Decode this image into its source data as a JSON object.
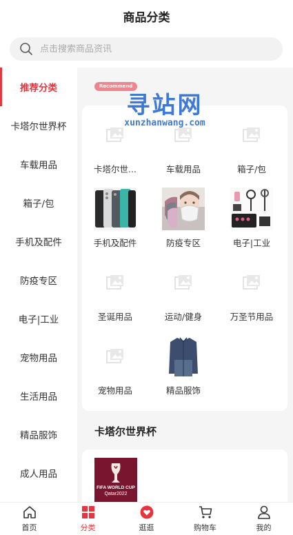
{
  "header": {
    "title": "商品分类"
  },
  "search": {
    "placeholder": "点击搜索商品资讯"
  },
  "sidebar": {
    "items": [
      {
        "label": "推荐分类",
        "active": true
      },
      {
        "label": "卡塔尔世界杯"
      },
      {
        "label": "车载用品"
      },
      {
        "label": "箱子/包"
      },
      {
        "label": "手机及配件"
      },
      {
        "label": "防疫专区"
      },
      {
        "label": "电子|工业"
      },
      {
        "label": "宠物用品"
      },
      {
        "label": "生活用品"
      },
      {
        "label": "精品服饰"
      },
      {
        "label": "成人用品"
      }
    ]
  },
  "content": {
    "badge": "Recommend",
    "watermark": {
      "text": "寻站网",
      "url": "xunzhanwang.com"
    },
    "grid": [
      {
        "label": "卡塔尔世...",
        "image": "placeholder-icon"
      },
      {
        "label": "车载用品",
        "image": "placeholder-icon"
      },
      {
        "label": "箱子/包",
        "image": "placeholder-icon"
      },
      {
        "label": "手机及配件",
        "image": "phones"
      },
      {
        "label": "防疫专区",
        "image": "masks"
      },
      {
        "label": "电子|工业",
        "image": "electronics"
      },
      {
        "label": "圣诞用品",
        "image": "placeholder-icon"
      },
      {
        "label": "运动/健身",
        "image": "placeholder-icon"
      },
      {
        "label": "万圣节用品",
        "image": "placeholder-icon"
      },
      {
        "label": "宠物用品",
        "image": "placeholder-icon"
      },
      {
        "label": "精品服饰",
        "image": "shirt"
      }
    ],
    "section_title": "卡塔尔世界杯",
    "section_item": {
      "logo_line1": "FIFA WORLD CUP",
      "logo_line2": "Qatar2022"
    }
  },
  "tabbar": {
    "tabs": [
      {
        "label": "首页",
        "icon": "home-icon"
      },
      {
        "label": "分类",
        "icon": "category-icon",
        "active": true
      },
      {
        "label": "逛逛",
        "icon": "heart-icon"
      },
      {
        "label": "购物车",
        "icon": "cart-icon"
      },
      {
        "label": "我的",
        "icon": "user-icon"
      }
    ]
  },
  "colors": {
    "accent": "#e8343c",
    "watermark": "#3d7ad6",
    "badge": "#f0848c"
  }
}
